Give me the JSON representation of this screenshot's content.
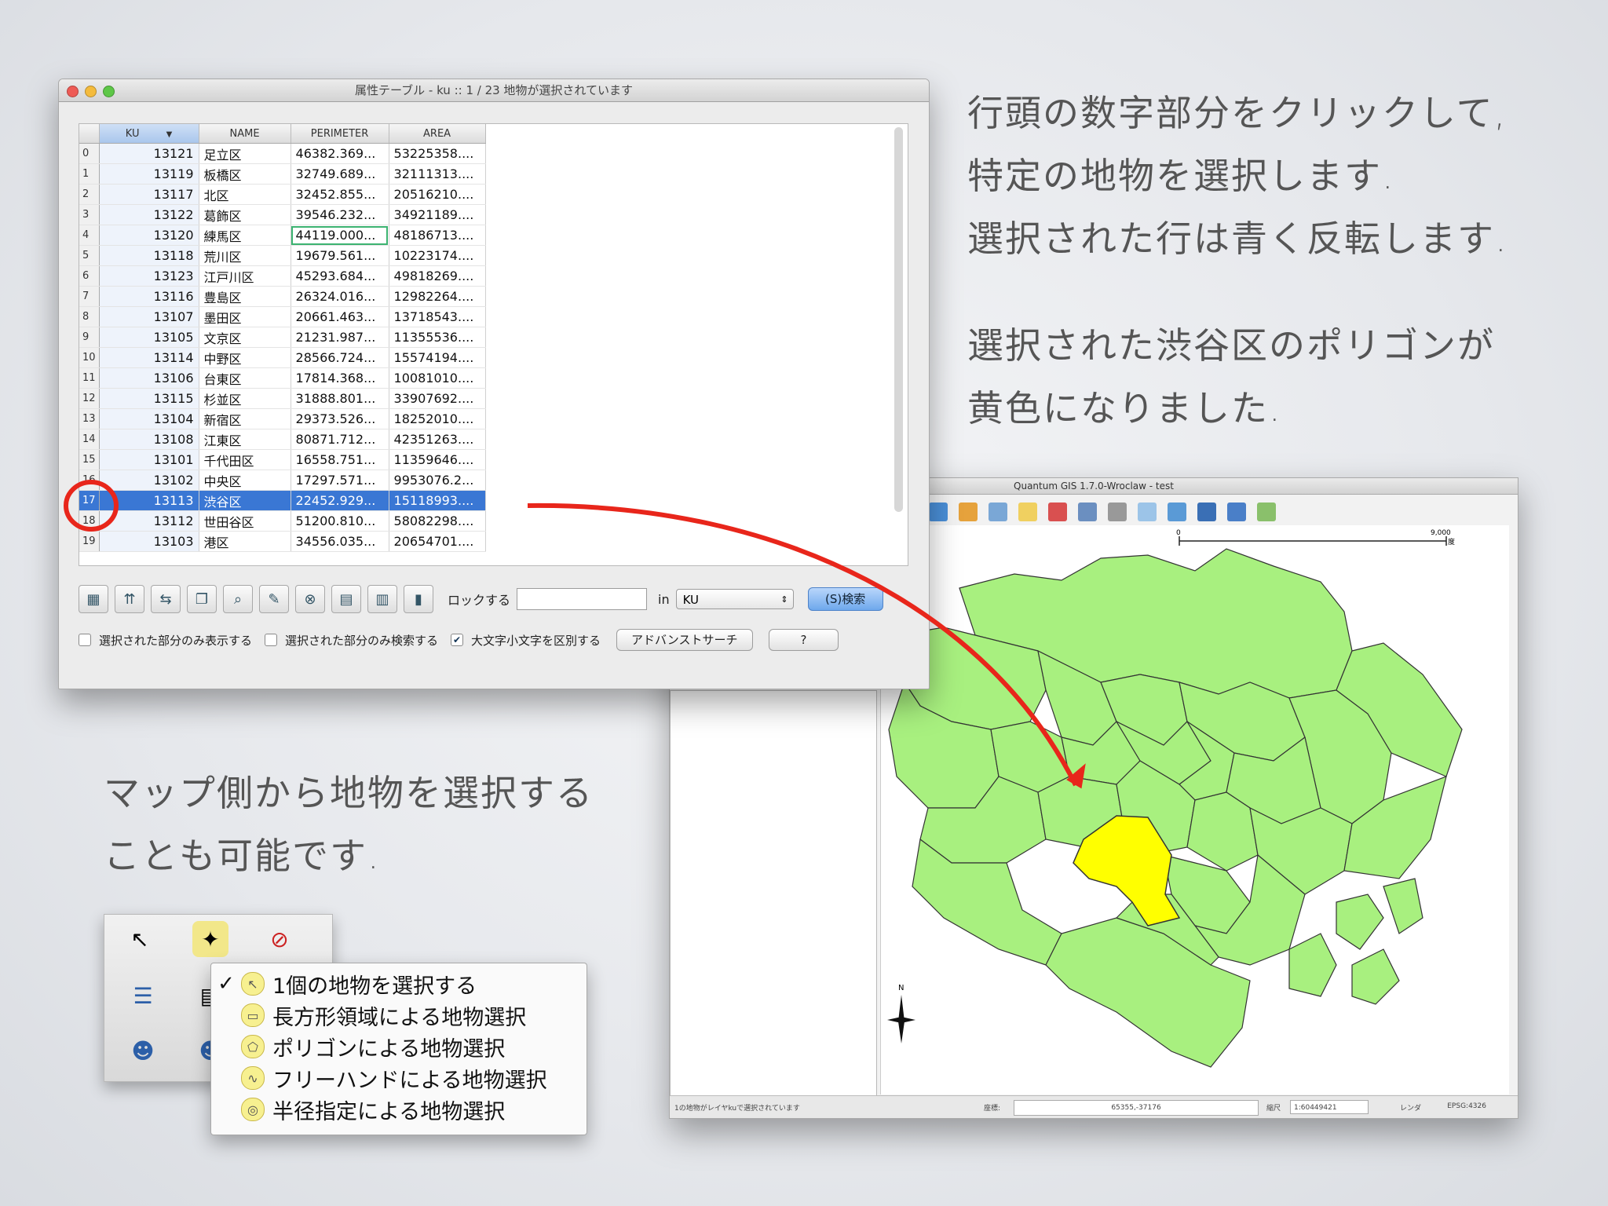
{
  "slide": {
    "text1_lines": [
      "行頭の数字部分をクリックして,",
      "特定の地物を選択します.",
      "選択された行は青く反転します."
    ],
    "text2_lines": [
      "選択された渋谷区のポリゴンが",
      "黄色になりました."
    ],
    "text3_lines": [
      "マップ側から地物を選択する",
      "ことも可能です."
    ]
  },
  "attr_window": {
    "title": "属性テーブル - ku :: 1 / 23 地物が選択されています",
    "columns": [
      "KU",
      "NAME",
      "PERIMETER",
      "AREA"
    ],
    "sort_indicator": "▼",
    "rows": [
      {
        "n": "0",
        "ku": "13121",
        "name": "足立区",
        "per": "46382.369...",
        "area": "53225358...."
      },
      {
        "n": "1",
        "ku": "13119",
        "name": "板橋区",
        "per": "32749.689...",
        "area": "32111313...."
      },
      {
        "n": "2",
        "ku": "13117",
        "name": "北区",
        "per": "32452.855...",
        "area": "20516210...."
      },
      {
        "n": "3",
        "ku": "13122",
        "name": "葛飾区",
        "per": "39546.232...",
        "area": "34921189...."
      },
      {
        "n": "4",
        "ku": "13120",
        "name": "練馬区",
        "per": "44119.000...",
        "area": "48186713...."
      },
      {
        "n": "5",
        "ku": "13118",
        "name": "荒川区",
        "per": "19679.561...",
        "area": "10223174...."
      },
      {
        "n": "6",
        "ku": "13123",
        "name": "江戸川区",
        "per": "45293.684...",
        "area": "49818269...."
      },
      {
        "n": "7",
        "ku": "13116",
        "name": "豊島区",
        "per": "26324.016...",
        "area": "12982264...."
      },
      {
        "n": "8",
        "ku": "13107",
        "name": "墨田区",
        "per": "20661.463...",
        "area": "13718543...."
      },
      {
        "n": "9",
        "ku": "13105",
        "name": "文京区",
        "per": "21231.987...",
        "area": "11355536...."
      },
      {
        "n": "10",
        "ku": "13114",
        "name": "中野区",
        "per": "28566.724...",
        "area": "15574194...."
      },
      {
        "n": "11",
        "ku": "13106",
        "name": "台東区",
        "per": "17814.368...",
        "area": "10081010...."
      },
      {
        "n": "12",
        "ku": "13115",
        "name": "杉並区",
        "per": "31888.801...",
        "area": "33907692...."
      },
      {
        "n": "13",
        "ku": "13104",
        "name": "新宿区",
        "per": "29373.526...",
        "area": "18252010...."
      },
      {
        "n": "14",
        "ku": "13108",
        "name": "江東区",
        "per": "80871.712...",
        "area": "42351263...."
      },
      {
        "n": "15",
        "ku": "13101",
        "name": "千代田区",
        "per": "16558.751...",
        "area": "11359646...."
      },
      {
        "n": "16",
        "ku": "13102",
        "name": "中央区",
        "per": "17297.571...",
        "area": "9953076.2..."
      },
      {
        "n": "17",
        "ku": "13113",
        "name": "渋谷区",
        "per": "22452.929...",
        "area": "15118993...."
      },
      {
        "n": "18",
        "ku": "13112",
        "name": "世田谷区",
        "per": "51200.810...",
        "area": "58082298...."
      },
      {
        "n": "19",
        "ku": "13103",
        "name": "港区",
        "per": "34556.035...",
        "area": "20654701...."
      }
    ],
    "selected_row": "17",
    "search_label": "ロックする",
    "in_label": "in",
    "field_select": "KU",
    "search_button": "(S)検索",
    "opt1": "選択された部分のみ表示する",
    "opt2": "選択された部分のみ検索する",
    "opt3": "大文字小文字を区別する",
    "advanced_button": "アドバンストサーチ",
    "help_button": "?"
  },
  "qgis": {
    "title": "Quantum GIS 1.7.0-Wroclaw - test",
    "scale_start": "0",
    "scale_end": "9,000",
    "scale_unit": "度",
    "status_msg": "1の地物がレイヤkuで選択されています",
    "coord_label": "座標:",
    "coord_value": "65355,-37176",
    "scale_label": "縮尺",
    "scale_value": "1:60449421",
    "render_label": "レンダ",
    "crs": "EPSG:4326",
    "north": "N"
  },
  "menu": {
    "items": [
      {
        "label": "1個の地物を選択する",
        "checked": "✓"
      },
      {
        "label": "長方形領域による地物選択",
        "checked": ""
      },
      {
        "label": "ポリゴンによる地物選択",
        "checked": ""
      },
      {
        "label": "フリーハンドによる地物選択",
        "checked": ""
      },
      {
        "label": "半径指定による地物選択",
        "checked": ""
      }
    ]
  },
  "colors": {
    "selection_blue": "#3a77d4",
    "ward_green": "#a8f07f",
    "selected_yellow": "#ffff00",
    "annotation_red": "#e8261b"
  }
}
